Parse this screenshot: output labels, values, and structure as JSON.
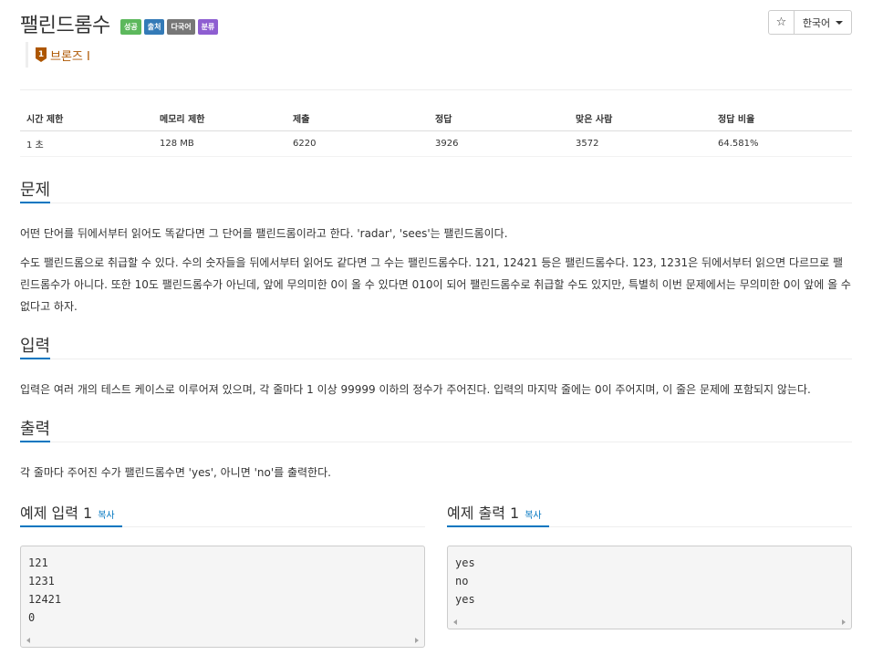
{
  "problem": {
    "title": "팰린드롬수",
    "badges": [
      "성공",
      "출처",
      "다국어",
      "분류"
    ],
    "star_icon": "☆",
    "language": "한국어",
    "tier": {
      "icon_text": "1",
      "label": "브론즈 I",
      "color": "#ad5600"
    }
  },
  "stats": {
    "headers": [
      "시간 제한",
      "메모리 제한",
      "제출",
      "정답",
      "맞은 사람",
      "정답 비율"
    ],
    "values": [
      "1 초",
      "128 MB",
      "6220",
      "3926",
      "3572",
      "64.581%"
    ]
  },
  "sections": {
    "problem_title": "문제",
    "problem_p1": "어떤 단어를 뒤에서부터 읽어도 똑같다면 그 단어를 팰린드롬이라고 한다. 'radar', 'sees'는 팰린드롬이다.",
    "problem_p2": "수도 팰린드롬으로 취급할 수 있다. 수의 숫자들을 뒤에서부터 읽어도 같다면 그 수는 팰린드롬수다. 121, 12421 등은 팰린드롬수다. 123, 1231은 뒤에서부터 읽으면 다르므로 팰린드롬수가 아니다. 또한 10도 팰린드롬수가 아닌데, 앞에 무의미한 0이 올 수 있다면 010이 되어 팰린드롬수로 취급할 수도 있지만, 특별히 이번 문제에서는 무의미한 0이 앞에 올 수 없다고 하자.",
    "input_title": "입력",
    "input_p": "입력은 여러 개의 테스트 케이스로 이루어져 있으며, 각 줄마다 1 이상 99999 이하의 정수가 주어진다. 입력의 마지막 줄에는 0이 주어지며, 이 줄은 문제에 포함되지 않는다.",
    "output_title": "출력",
    "output_p": "각 줄마다 주어진 수가 팰린드롬수면 'yes', 아니면 'no'를 출력한다."
  },
  "examples": {
    "input_title": "예제 입력 1",
    "output_title": "예제 출력 1",
    "copy_label": "복사",
    "input_lines": [
      "121",
      "1231",
      "12421",
      "0"
    ],
    "output_lines": [
      "yes",
      "no",
      "yes"
    ]
  },
  "colors": {
    "accent": "#0076c0",
    "success": "#5cb85c",
    "primary": "#337ab7",
    "gray": "#777777",
    "purple": "#8e5ed1"
  }
}
